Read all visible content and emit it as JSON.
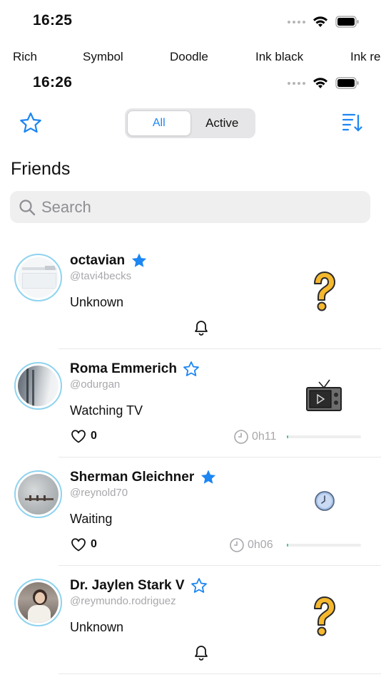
{
  "status_bar_top": {
    "time": "16:25"
  },
  "font_strip": [
    "Rich",
    "Symbol",
    "Doodle",
    "Ink black",
    "Ink re"
  ],
  "status_bar": {
    "time": "16:26"
  },
  "nav": {
    "segments": [
      {
        "label": "All",
        "selected": true
      },
      {
        "label": "Active",
        "selected": false
      }
    ],
    "favorite_icon": "star-outline-icon",
    "sort_icon": "sort-list-icon"
  },
  "page_title": "Friends",
  "search": {
    "placeholder": "Search",
    "value": ""
  },
  "accent_color": "#1c86f2",
  "friends": [
    {
      "name": "octavian",
      "handle": "@tavi4becks",
      "favorite": true,
      "activity": "Unknown",
      "activity_icon": "question-mark-icon",
      "has_bell": true,
      "likes": null,
      "timer": null,
      "progress": null
    },
    {
      "name": "Roma Emmerich",
      "handle": "@odurgan",
      "favorite": false,
      "activity": "Watching TV",
      "activity_icon": "tv-icon",
      "has_bell": false,
      "likes": "0",
      "timer": "0h11",
      "progress": 0.02
    },
    {
      "name": "Sherman Gleichner",
      "handle": "@reynold70",
      "favorite": true,
      "activity": "Waiting",
      "activity_icon": "clock-icon",
      "has_bell": false,
      "likes": "0",
      "timer": "0h06",
      "progress": 0.02
    },
    {
      "name": "Dr. Jaylen Stark V",
      "handle": "@reymundo.rodriguez",
      "favorite": false,
      "activity": "Unknown",
      "activity_icon": "question-mark-icon",
      "has_bell": true,
      "likes": null,
      "timer": null,
      "progress": null
    }
  ]
}
